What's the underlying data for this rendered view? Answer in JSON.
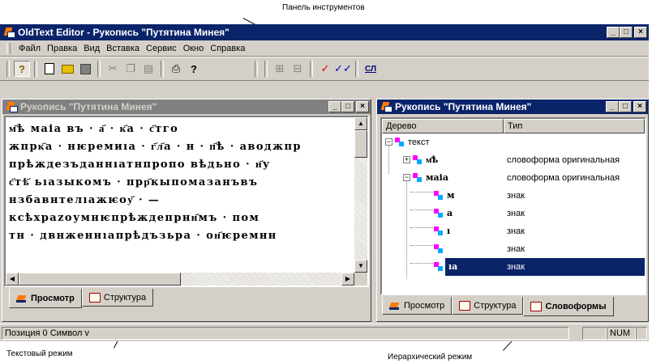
{
  "annotations": {
    "toolbar_label": "Панель инструментов",
    "text_mode_label": "Текстовый режим",
    "hierarchy_mode_label": "Иерархический режим"
  },
  "app": {
    "title": "OldText Editor - Рукопись \"Путятина Минея\""
  },
  "menu": {
    "items": [
      "Файл",
      "Правка",
      "Вид",
      "Вставка",
      "Сервис",
      "Окно",
      "Справка"
    ]
  },
  "toolbar": {
    "icons": [
      "info-icon",
      "new-document-icon",
      "open-folder-icon",
      "save-icon",
      "cut-icon",
      "copy-icon",
      "paste-icon",
      "print-icon",
      "help-icon",
      "grid-view-icon",
      "tree-view-icon",
      "check-icon",
      "double-check-icon",
      "dictionary-icon"
    ],
    "dictionary_label": "СЛ"
  },
  "text_window": {
    "title": "Рукопись \"Путятина Минея\"",
    "lines": [
      "м҃ѣ маіа въ · а҃ · к҃а · с҃тго",
      "жпрк҃а · нѥремиıа · г҃л҃а · н · п҃ѣ · аводжпр",
      "прѣждезъданнıатнпропо вѣдьно · н҃у",
      "с҃тѣ҃ ьıазыкомъ · прр҃кыпомазанъвъ",
      "нзбавнтелıажѥоу҃ · —",
      "ксѣхраzоумнѥпрѣждепрнн҃мъ · пом",
      "тн · двнженнıапрѣдъзьра · он҃ѥремнн"
    ],
    "tabs": [
      {
        "label": "Просмотр",
        "active": true
      },
      {
        "label": "Структура",
        "active": false
      }
    ]
  },
  "tree_window": {
    "title": "Рукопись \"Путятина Минея\"",
    "columns": [
      "Дерево",
      "Тип"
    ],
    "rows": [
      {
        "label": "текст",
        "type": ""
      },
      {
        "label": "м҃ѣ",
        "type": "словоформа оригинальная"
      },
      {
        "label": "маіа",
        "type": "словоформа оригинальная"
      },
      {
        "label": "м",
        "type": "знак"
      },
      {
        "label": "а",
        "type": "знак"
      },
      {
        "label": "ı",
        "type": "знак"
      },
      {
        "label": "",
        "type": "знак"
      },
      {
        "label": "ıа",
        "type": "знак"
      }
    ],
    "tabs": [
      {
        "label": "Просмотр",
        "active": false
      },
      {
        "label": "Структура",
        "active": false
      },
      {
        "label": "Словоформы",
        "active": true
      }
    ]
  },
  "status": {
    "position_text": "Позиция 0 Символ v",
    "num_indicator": "NUM"
  },
  "colors": {
    "title_active": "#0a246a",
    "title_inactive": "#808080",
    "face": "#d4d0c8",
    "selection": "#0a246a"
  }
}
